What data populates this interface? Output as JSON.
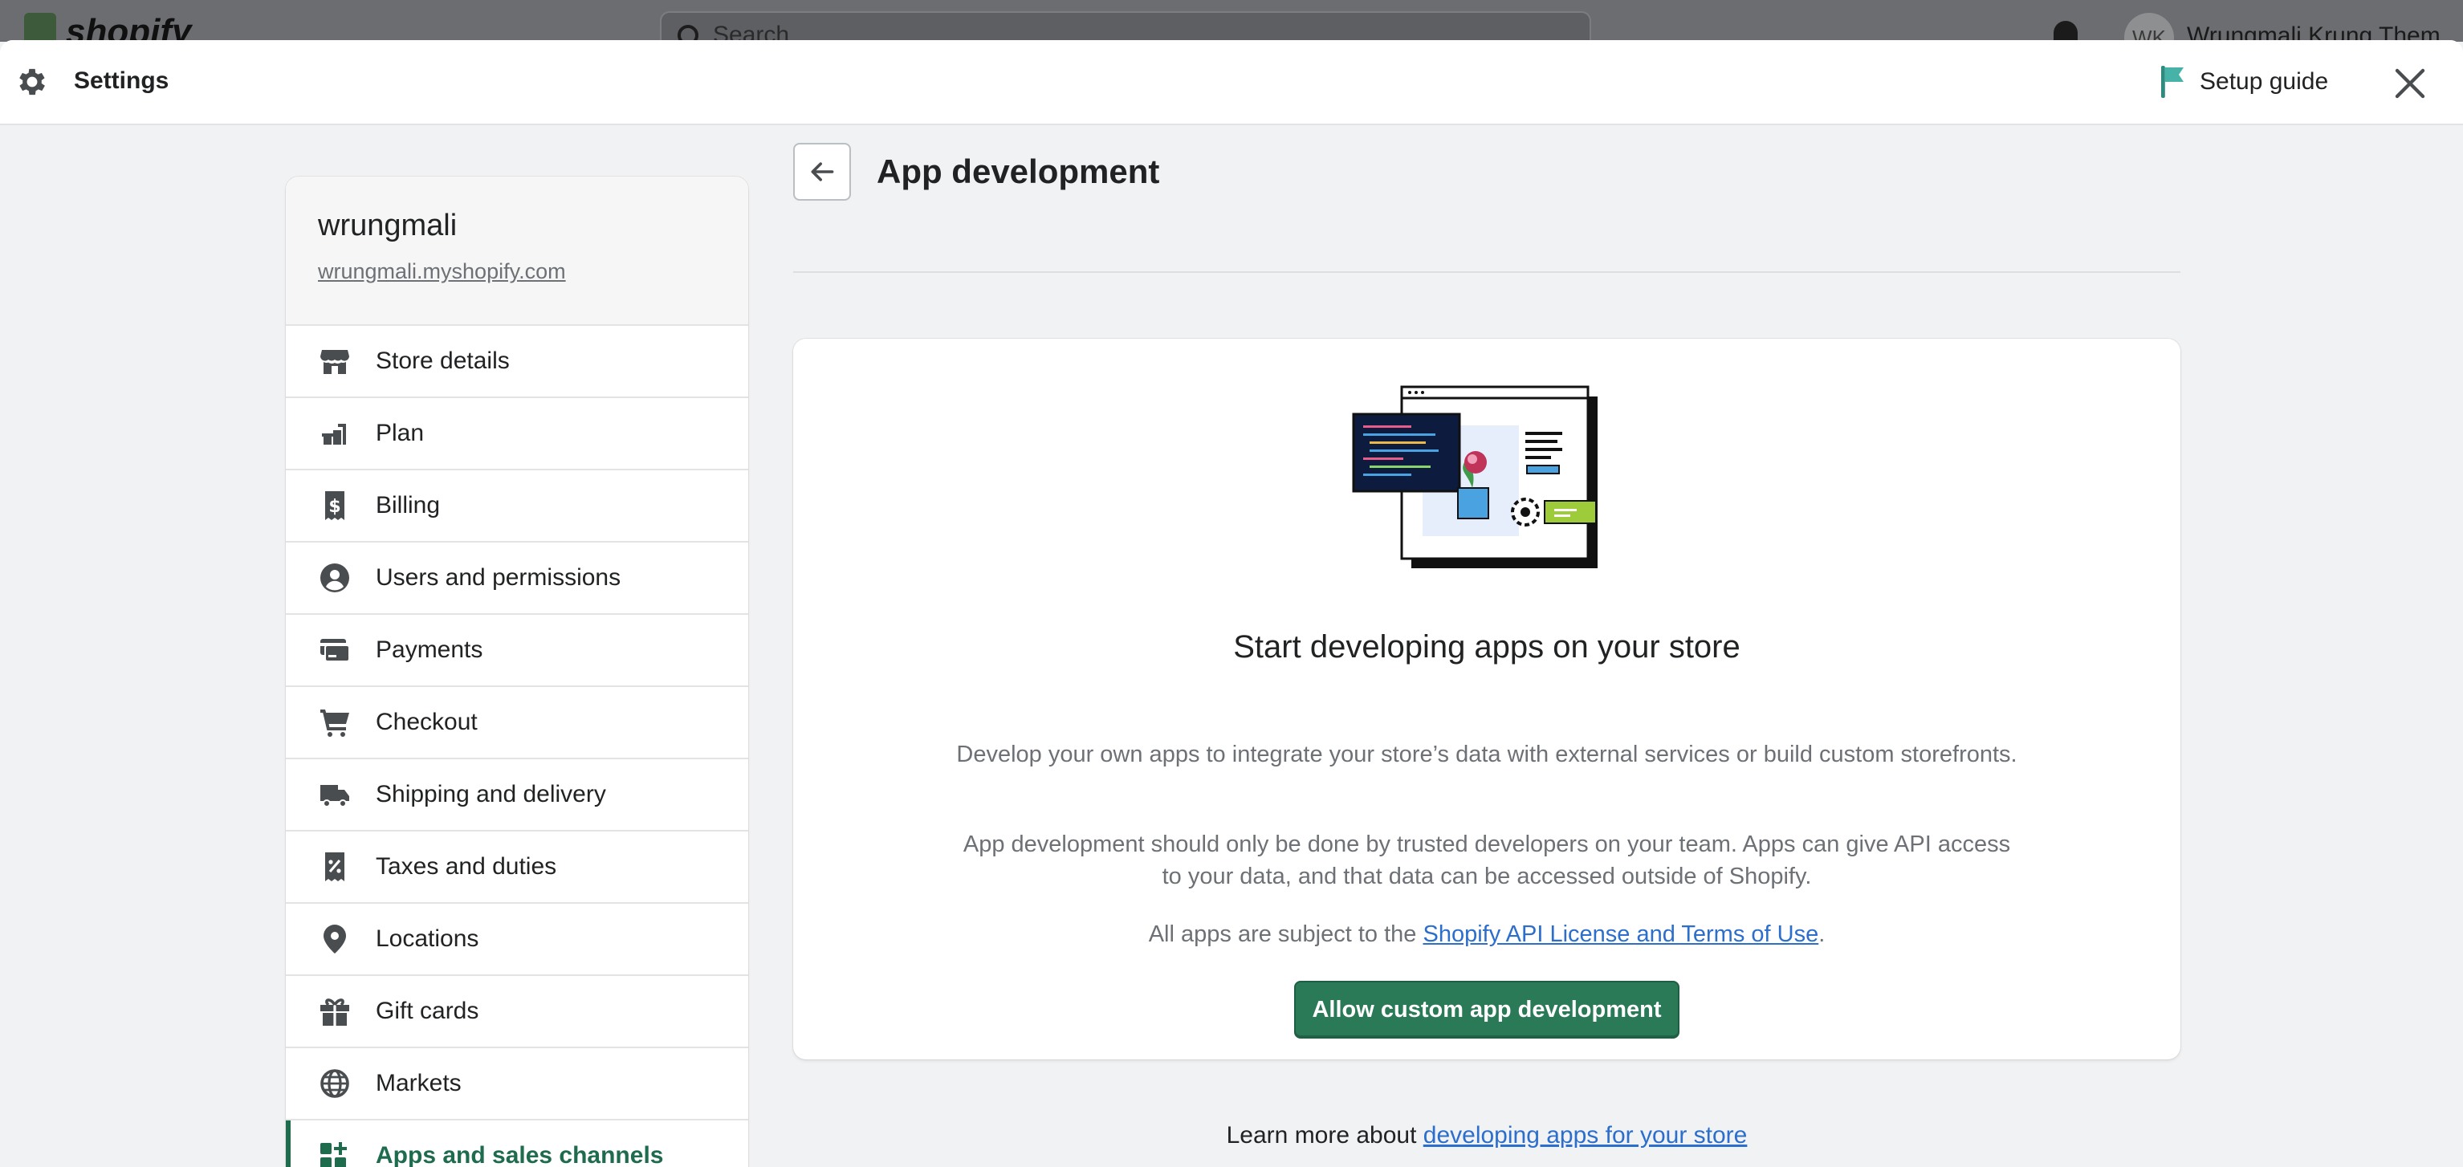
{
  "background": {
    "brand": "shopify",
    "search_placeholder": "Search",
    "user_initials": "WK",
    "user_name": "Wrungmali Krung Them"
  },
  "header": {
    "title": "Settings",
    "setup_guide_label": "Setup guide",
    "gear_icon": "gear-icon",
    "flag_icon": "flag-icon",
    "close_icon": "close-icon"
  },
  "store": {
    "name": "wrungmali",
    "url": "wrungmali.myshopify.com"
  },
  "sidebar": {
    "items": [
      {
        "label": "Store details",
        "icon": "store-icon"
      },
      {
        "label": "Plan",
        "icon": "plan-icon"
      },
      {
        "label": "Billing",
        "icon": "billing-icon"
      },
      {
        "label": "Users and permissions",
        "icon": "user-icon"
      },
      {
        "label": "Payments",
        "icon": "payments-icon"
      },
      {
        "label": "Checkout",
        "icon": "cart-icon"
      },
      {
        "label": "Shipping and delivery",
        "icon": "truck-icon"
      },
      {
        "label": "Taxes and duties",
        "icon": "tax-icon"
      },
      {
        "label": "Locations",
        "icon": "location-pin-icon"
      },
      {
        "label": "Gift cards",
        "icon": "gift-icon"
      },
      {
        "label": "Markets",
        "icon": "globe-icon"
      },
      {
        "label": "Apps and sales channels",
        "icon": "apps-icon",
        "active": true
      }
    ]
  },
  "main": {
    "title": "App development",
    "card": {
      "heading": "Start developing apps on your store",
      "paragraph1": "Develop your own apps to integrate your store’s data with external services or build custom storefronts.",
      "paragraph2": "App development should only be done by trusted developers on your team. Apps can give API access to your data, and that data can be accessed outside of Shopify.",
      "paragraph3_prefix": "All apps are subject to the ",
      "paragraph3_link": "Shopify API License and Terms of Use",
      "paragraph3_suffix": ".",
      "button_label": "Allow custom app development"
    },
    "learn_more_prefix": "Learn more about ",
    "learn_more_link": "developing apps for your store"
  },
  "colors": {
    "primary_button": "#2b7a57",
    "link": "#2c6ecb",
    "active_nav": "#1f6b4e",
    "setup_flag": "#47b3a8"
  }
}
